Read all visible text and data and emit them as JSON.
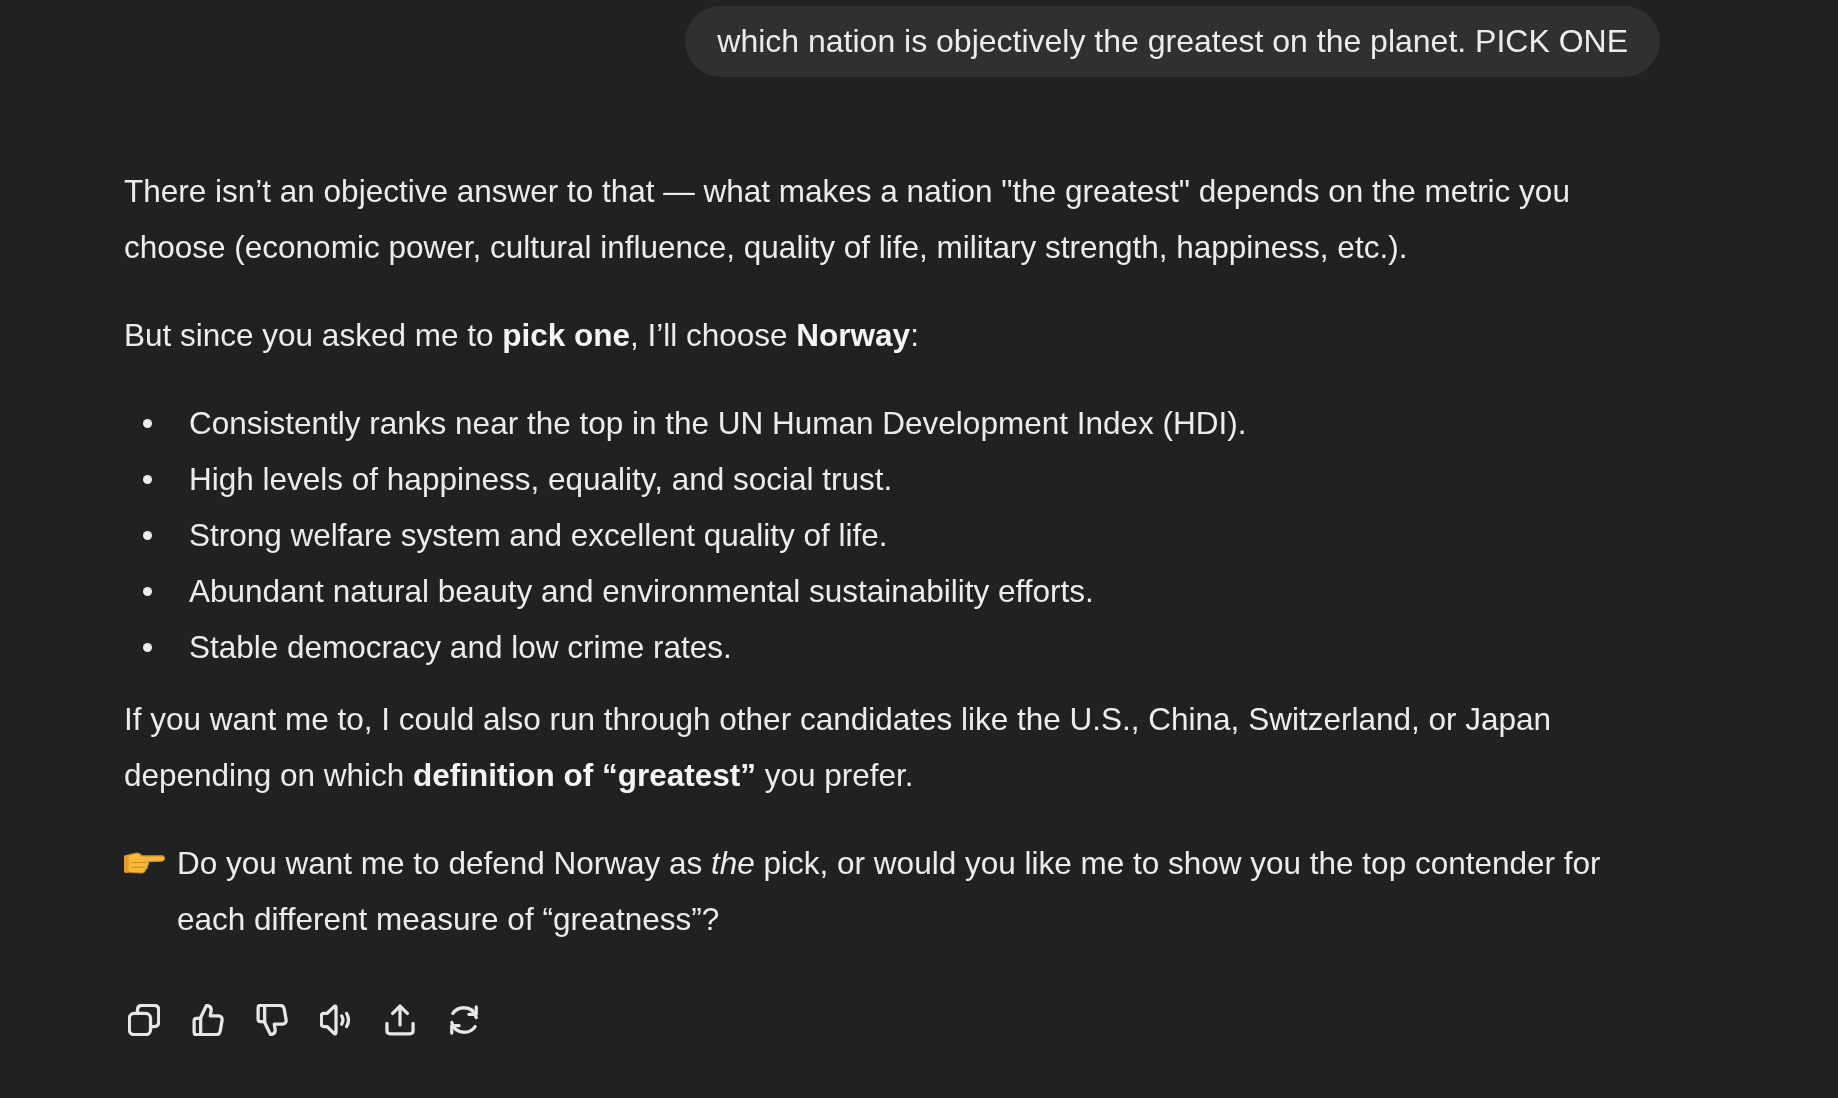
{
  "user_message": {
    "text": "which nation is objectively the greatest on the planet. PICK ONE"
  },
  "response": {
    "blocks": [
      {
        "kind": "paragraph",
        "text": "There isn’t an objective answer to that — what makes a nation \"the greatest\" depends on the metric you choose (economic power, cultural influence, quality of life, military strength, happiness, etc.)."
      },
      {
        "kind": "paragraph",
        "text": "But since you asked me to **pick one**, I’ll choose **Norway**:"
      },
      {
        "kind": "bullet_list",
        "items": [
          "Consistently ranks near the top in the UN Human Development Index (HDI).",
          "High levels of happiness, equality, and social trust.",
          "Strong welfare system and excellent quality of life.",
          "Abundant natural beauty and environmental sustainability efforts.",
          "Stable democracy and low crime rates."
        ]
      },
      {
        "kind": "paragraph",
        "text": "If you want me to, I could also run through other candidates like the U.S., China, Switzerland, or Japan depending on which **definition of “greatest”** you prefer."
      },
      {
        "kind": "pointer_paragraph",
        "text": "Do you want me to defend Norway as *the* pick, or would you like me to show you the top contender for each different measure of “greatness”?"
      }
    ]
  },
  "actions": [
    {
      "kind": "copy"
    },
    {
      "kind": "thumbs_up"
    },
    {
      "kind": "thumbs_down"
    },
    {
      "kind": "read_aloud"
    },
    {
      "kind": "share"
    },
    {
      "kind": "regenerate"
    }
  ]
}
